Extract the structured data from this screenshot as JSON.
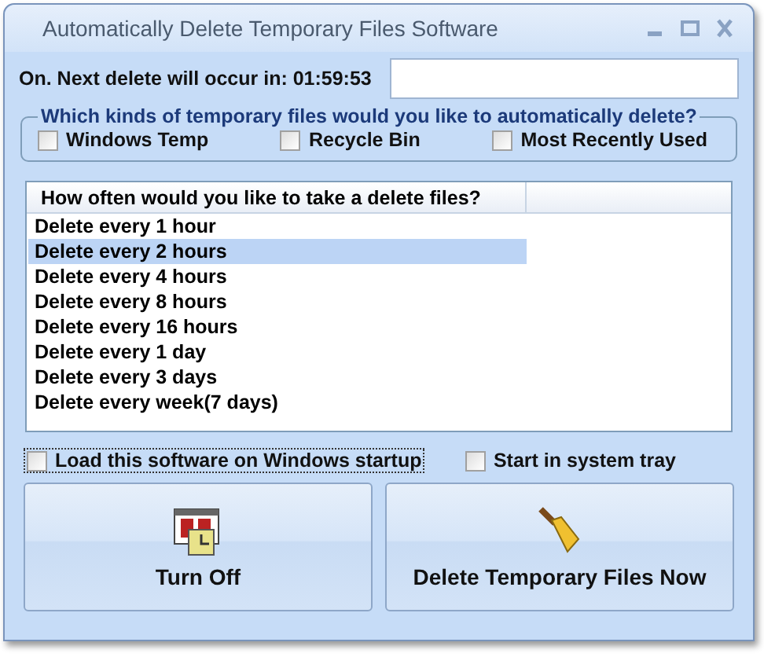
{
  "window": {
    "title": "Automatically Delete Temporary Files Software"
  },
  "status": {
    "text": "On. Next delete will occur in: 01:59:53"
  },
  "file_types": {
    "title": "Which kinds of temporary files would you like to automatically delete?",
    "options": [
      {
        "label": "Windows Temp",
        "checked": false
      },
      {
        "label": "Recycle Bin",
        "checked": false
      },
      {
        "label": "Most Recently Used",
        "checked": false
      }
    ]
  },
  "schedule": {
    "column": "How often would you like to take a delete files?",
    "items": [
      {
        "label": "Delete every 1 hour",
        "selected": false
      },
      {
        "label": "Delete every 2 hours",
        "selected": true
      },
      {
        "label": "Delete every 4 hours",
        "selected": false
      },
      {
        "label": "Delete every 8 hours",
        "selected": false
      },
      {
        "label": "Delete every 16 hours",
        "selected": false
      },
      {
        "label": "Delete every 1 day",
        "selected": false
      },
      {
        "label": "Delete every 3 days",
        "selected": false
      },
      {
        "label": "Delete every week(7 days)",
        "selected": false
      }
    ]
  },
  "options": [
    {
      "label": "Load this software on Windows startup",
      "checked": false,
      "focused": true
    },
    {
      "label": "Start in system tray",
      "checked": false,
      "focused": false
    }
  ],
  "buttons": [
    {
      "label": "Turn Off",
      "kind": "calendar"
    },
    {
      "label": "Delete Temporary Files Now",
      "kind": "broom"
    }
  ]
}
